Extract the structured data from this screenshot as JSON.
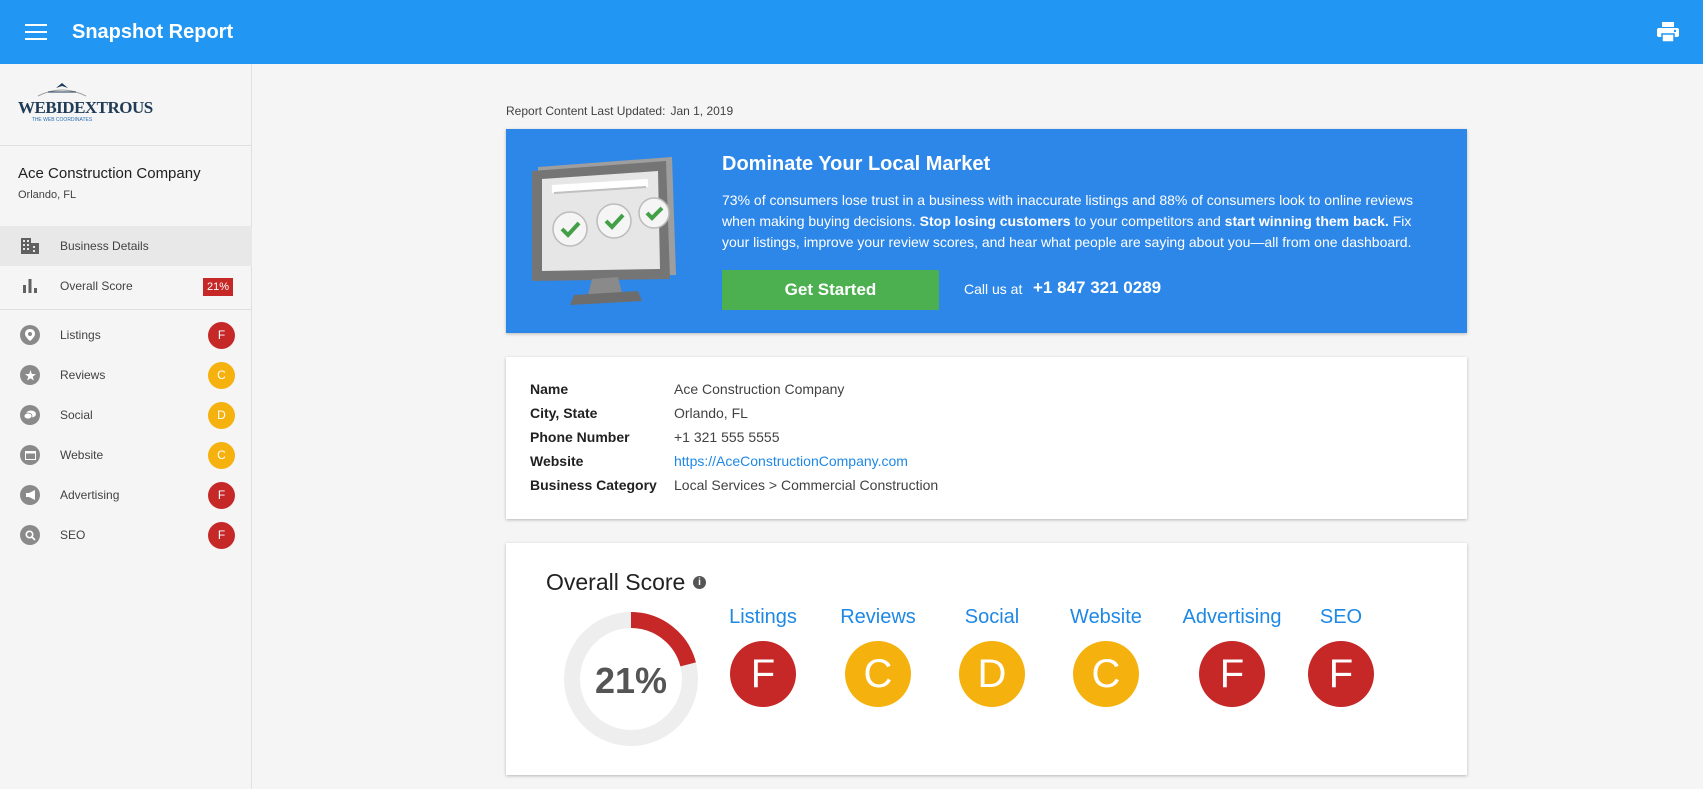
{
  "header": {
    "title": "Snapshot Report"
  },
  "sidebar": {
    "logo_text": "WEBIDEXTROUS",
    "logo_tagline": "THE WEB COORDINATES",
    "business_name": "Ace Construction Company",
    "business_location": "Orlando, FL",
    "items": [
      {
        "label": "Business Details",
        "icon": "building-icon",
        "active": true
      },
      {
        "label": "Overall Score",
        "icon": "bar-chart-icon",
        "badge": "21%"
      },
      {
        "label": "Listings",
        "icon": "location-pin-icon",
        "grade": "F"
      },
      {
        "label": "Reviews",
        "icon": "star-icon",
        "grade": "C"
      },
      {
        "label": "Social",
        "icon": "chat-bubble-icon",
        "grade": "D"
      },
      {
        "label": "Website",
        "icon": "browser-icon",
        "grade": "C"
      },
      {
        "label": "Advertising",
        "icon": "megaphone-icon",
        "grade": "F"
      },
      {
        "label": "SEO",
        "icon": "search-icon",
        "grade": "F"
      }
    ]
  },
  "report": {
    "updated_label": "Report Content Last Updated:",
    "updated_value": "Jan 1, 2019"
  },
  "promo": {
    "title": "Dominate Your Local Market",
    "body_part1": "73% of consumers lose trust in a business with inaccurate listings and 88% of consumers look to online reviews when making buying decisions. ",
    "body_bold1": "Stop losing customers",
    "body_part2": " to your competitors and ",
    "body_bold2": "start winning them back.",
    "body_part3": " Fix your listings, improve your review scores, and hear what people are saying about you—all from one dashboard.",
    "button_label": "Get Started",
    "call_label": "Call us at",
    "phone": "+1 847 321 0289"
  },
  "details": {
    "rows": [
      {
        "label": "Name",
        "value": "Ace Construction Company"
      },
      {
        "label": "City, State",
        "value": "Orlando, FL"
      },
      {
        "label": "Phone Number",
        "value": "+1 321 555 5555"
      },
      {
        "label": "Website",
        "value": "https://AceConstructionCompany.com"
      },
      {
        "label": "Business Category",
        "value": "Local Services > Commercial Construction"
      }
    ]
  },
  "overall": {
    "title": "Overall Score",
    "score_text": "21%",
    "score_fraction": 0.21,
    "categories": [
      {
        "label": "Listings",
        "grade": "F"
      },
      {
        "label": "Reviews",
        "grade": "C"
      },
      {
        "label": "Social",
        "grade": "D"
      },
      {
        "label": "Website",
        "grade": "C"
      },
      {
        "label": "Advertising",
        "grade": "F"
      },
      {
        "label": "SEO",
        "grade": "F"
      }
    ]
  },
  "colors": {
    "header_blue": "#2196f3",
    "promo_blue": "#2d87e8",
    "grade_red": "#c62828",
    "grade_yellow": "#f5b10e",
    "cta_green": "#4caf50",
    "link_blue": "#1e88e5"
  }
}
